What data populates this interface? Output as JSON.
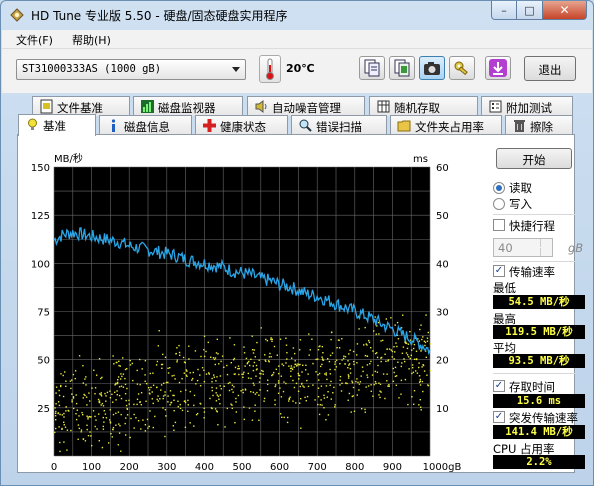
{
  "window": {
    "title": "HD Tune 专业版 5.50 - 硬盘/固态硬盘实用程序",
    "minimize": "–",
    "maximize": "□",
    "close": "✕"
  },
  "menu": {
    "file": "文件(F)",
    "help": "帮助(H)"
  },
  "toolbar": {
    "drive": "ST31000333AS  (1000 gB)",
    "temperature": "20℃",
    "exit_label": "退出",
    "icons": [
      "copy-text-icon",
      "copy-info-icon",
      "screenshot-icon",
      "options-icon",
      "save-icon"
    ]
  },
  "tabs_top": [
    {
      "label": "文件基准",
      "icon": "file-benchmark-icon"
    },
    {
      "label": "磁盘监视器",
      "icon": "disk-monitor-icon"
    },
    {
      "label": "自动噪音管理",
      "icon": "noise-management-icon"
    },
    {
      "label": "随机存取",
      "icon": "random-access-icon"
    },
    {
      "label": "附加测试",
      "icon": "extra-tests-icon"
    }
  ],
  "tabs_bottom": [
    {
      "label": "基准",
      "icon": "benchmark-icon"
    },
    {
      "label": "磁盘信息",
      "icon": "disk-info-icon"
    },
    {
      "label": "健康状态",
      "icon": "health-icon"
    },
    {
      "label": "错误扫描",
      "icon": "error-scan-icon"
    },
    {
      "label": "文件夹占用率",
      "icon": "folder-usage-icon"
    },
    {
      "label": "擦除",
      "icon": "erase-icon"
    }
  ],
  "controls": {
    "start_label": "开始",
    "read_label": "读取",
    "write_label": "写入",
    "read_selected": true,
    "quick_stroke_label": "快捷行程",
    "quick_stroke_value": "40",
    "quick_stroke_unit": "gB",
    "transfer_rate_label": "传输速率",
    "min_label": "最低",
    "min_value": "54.5 MB/秒",
    "max_label": "最高",
    "max_value": "119.5 MB/秒",
    "avg_label": "平均",
    "avg_value": "93.5 MB/秒",
    "access_time_label": "存取时间",
    "access_time_value": "15.6 ms",
    "burst_label": "突发传输速率",
    "burst_value": "141.4 MB/秒",
    "cpu_label": "CPU 占用率",
    "cpu_value": "2.2%"
  },
  "chart_data": {
    "type": "line",
    "y_left_label": "MB/秒",
    "y_right_label": "ms",
    "x_unit": "gB",
    "x_ticks": [
      "0",
      "100",
      "200",
      "300",
      "400",
      "500",
      "600",
      "700",
      "800",
      "900",
      "1000gB"
    ],
    "y_left_ticks": [
      "150",
      "125",
      "100",
      "75",
      "50",
      "25"
    ],
    "y_right_ticks": [
      "60",
      "50",
      "40",
      "30",
      "20",
      "10"
    ],
    "xlim": [
      0,
      1000
    ],
    "ylim_left": [
      0,
      150
    ],
    "ylim_right": [
      0,
      60
    ],
    "colors": {
      "background": "#000000",
      "grid": "#6a6a6a",
      "transfer": "#2aa6e8",
      "access": "#e8e83a"
    },
    "series": [
      {
        "name": "传输速率",
        "axis": "left",
        "x": [
          0,
          25,
          50,
          75,
          100,
          125,
          150,
          175,
          200,
          225,
          250,
          275,
          300,
          325,
          350,
          375,
          400,
          425,
          450,
          475,
          500,
          525,
          550,
          575,
          600,
          625,
          650,
          675,
          700,
          725,
          750,
          775,
          800,
          825,
          850,
          875,
          900,
          925,
          950,
          975,
          1000
        ],
        "values": [
          112,
          115,
          116,
          115,
          114,
          113,
          112,
          111,
          109,
          108,
          107,
          106,
          105,
          104,
          102,
          101,
          100,
          99,
          98,
          96,
          95,
          94,
          92,
          91,
          89,
          88,
          86,
          84,
          83,
          81,
          79,
          77,
          75,
          73,
          71,
          68,
          66,
          63,
          61,
          58,
          55
        ]
      },
      {
        "name": "存取时间",
        "axis": "right",
        "trend_x": [
          0,
          100,
          200,
          300,
          400,
          500,
          600,
          700,
          800,
          900,
          1000
        ],
        "trend_ms": [
          10,
          11.5,
          12.8,
          14,
          15,
          16,
          17,
          18,
          19,
          20,
          20.5
        ]
      }
    ]
  }
}
